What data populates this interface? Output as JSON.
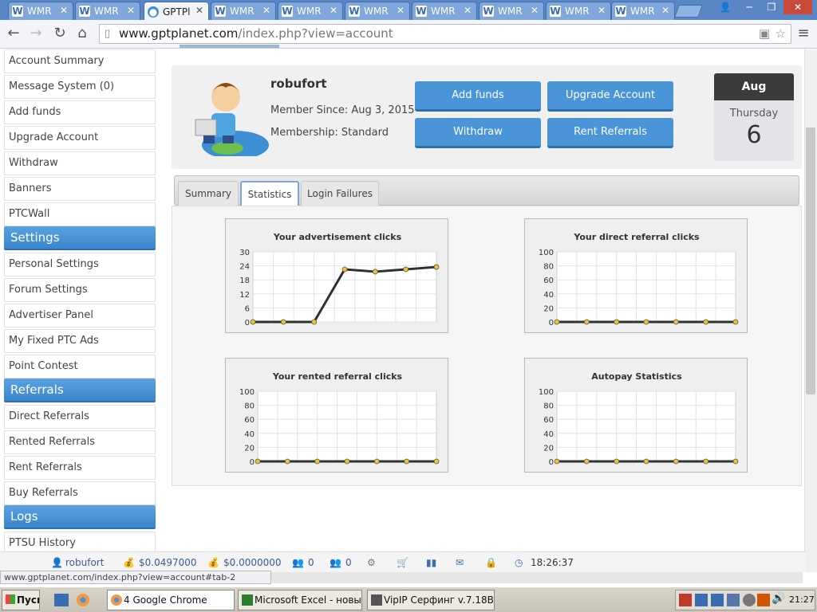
{
  "browser": {
    "tabs": [
      {
        "label": "WMR"
      },
      {
        "label": "WMR"
      },
      {
        "label": "GPTPl",
        "active": true
      },
      {
        "label": "WMR"
      },
      {
        "label": "WMR"
      },
      {
        "label": "WMR"
      },
      {
        "label": "WMR"
      },
      {
        "label": "WMR"
      },
      {
        "label": "WMR"
      },
      {
        "label": "WMR"
      }
    ],
    "url_domain": "www.gptplanet.com",
    "url_path": "/index.php?view=account",
    "status_url": "www.gptplanet.com/index.php?view=account#tab-2"
  },
  "sidebar": {
    "items": [
      {
        "label": "Account Summary"
      },
      {
        "label": "Message System (0)"
      },
      {
        "label": "Add funds"
      },
      {
        "label": "Upgrade Account"
      },
      {
        "label": "Withdraw"
      },
      {
        "label": "Banners"
      },
      {
        "label": "PTCWall"
      },
      {
        "header": "Settings"
      },
      {
        "label": "Personal Settings"
      },
      {
        "label": "Forum Settings"
      },
      {
        "label": "Advertiser Panel"
      },
      {
        "label": "My Fixed PTC Ads"
      },
      {
        "label": "Point Contest"
      },
      {
        "header": "Referrals"
      },
      {
        "label": "Direct Referrals"
      },
      {
        "label": "Rented Referrals"
      },
      {
        "label": "Rent Referrals"
      },
      {
        "label": "Buy Referrals"
      },
      {
        "header": "Logs"
      },
      {
        "label": "PTSU History"
      }
    ]
  },
  "profile": {
    "username": "robufort",
    "member_since": "Member Since: Aug 3, 2015",
    "membership": "Membership: Standard",
    "buttons": {
      "add_funds": "Add funds",
      "upgrade": "Upgrade Account",
      "withdraw": "Withdraw",
      "rent": "Rent Referrals"
    },
    "date": {
      "month": "Aug",
      "weekday": "Thursday",
      "day": "6"
    }
  },
  "tabs": {
    "summary": "Summary",
    "statistics": "Statistics",
    "login_failures": "Login Failures"
  },
  "chart_data": [
    {
      "type": "line",
      "title": "Your advertisement clicks",
      "ylim": [
        0,
        30
      ],
      "yticks": [
        0,
        6,
        12,
        18,
        24,
        30
      ],
      "series": [
        {
          "values": [
            0,
            0,
            0,
            22.5,
            21.5,
            22.5,
            23.5
          ]
        }
      ]
    },
    {
      "type": "line",
      "title": "Your direct referral clicks",
      "ylim": [
        0,
        100
      ],
      "yticks": [
        0,
        20,
        40,
        60,
        80,
        100
      ],
      "series": [
        {
          "values": [
            0,
            0,
            0,
            0,
            0,
            0,
            0
          ]
        }
      ]
    },
    {
      "type": "line",
      "title": "Your rented referral clicks",
      "ylim": [
        0,
        100
      ],
      "yticks": [
        0,
        20,
        40,
        60,
        80,
        100
      ],
      "series": [
        {
          "values": [
            0,
            0,
            0,
            0,
            0,
            0,
            0
          ]
        }
      ]
    },
    {
      "type": "line",
      "title": "Autopay Statistics",
      "ylim": [
        0,
        100
      ],
      "yticks": [
        0,
        20,
        40,
        60,
        80,
        100
      ],
      "series": [
        {
          "values": [
            0,
            0,
            0,
            0,
            0,
            0,
            0
          ]
        }
      ]
    }
  ],
  "statusbar": {
    "user": "robufort",
    "balance1": "$0.0497000",
    "balance2": "$0.0000000",
    "count1": "0",
    "count2": "0",
    "time": "18:26:37"
  },
  "taskbar": {
    "start": "Пуск",
    "chrome": "4 Google Chrome",
    "excel": "Microsoft Excel - новы...",
    "vipip": "VipIP Серфинг  v.7.18B...",
    "clock": "21:27"
  },
  "colors": {
    "accent": "#4a95d8",
    "line": "#2f3030",
    "point": "#f2c230"
  }
}
